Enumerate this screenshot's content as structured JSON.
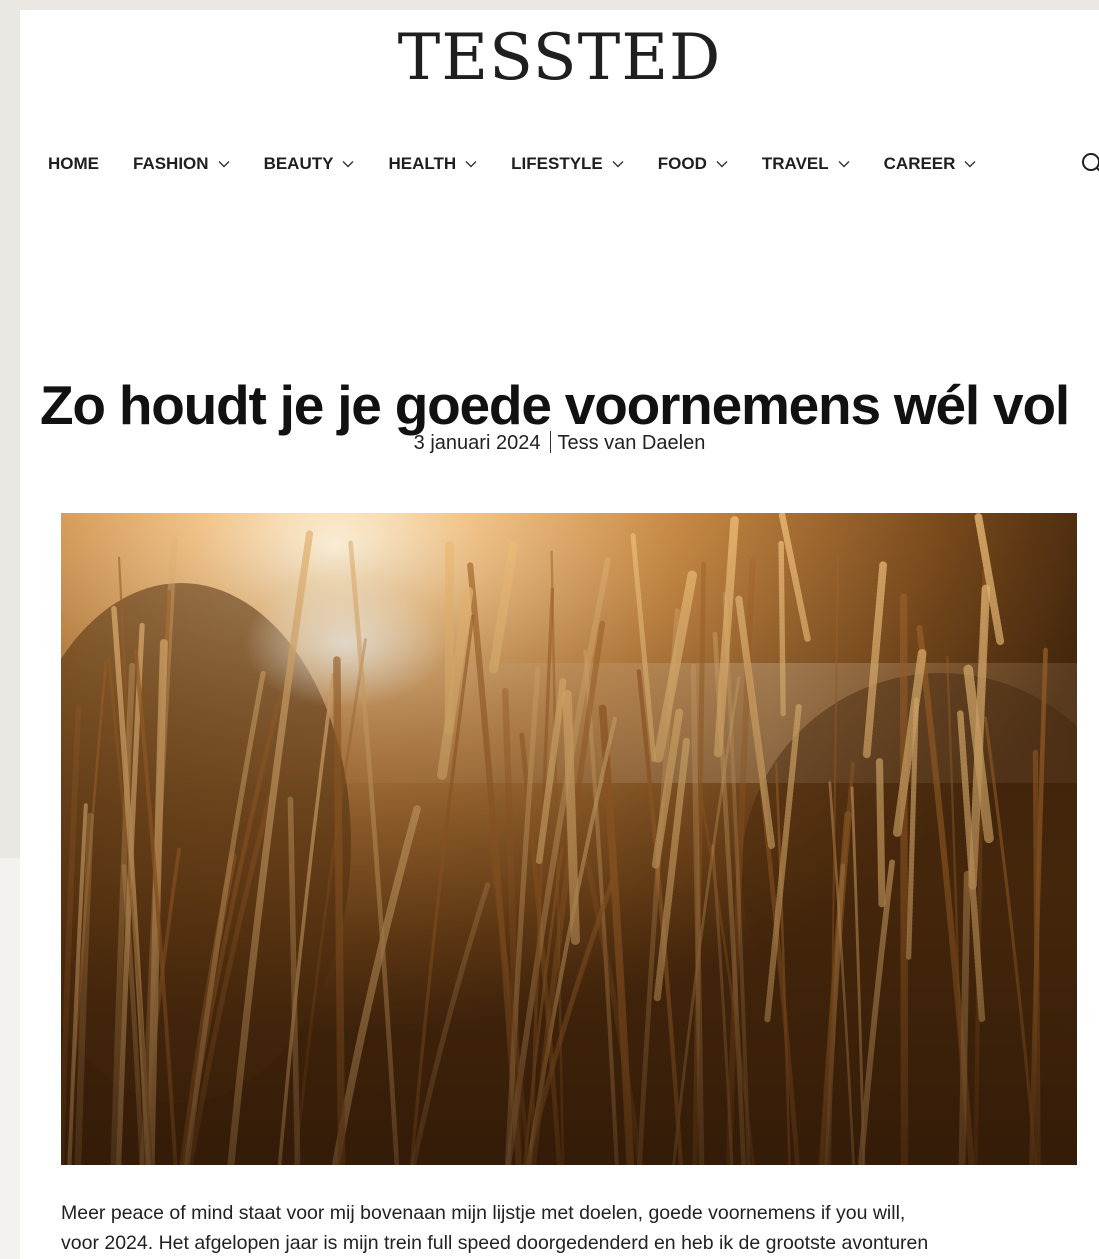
{
  "brand": {
    "logo": "TESSTED"
  },
  "nav": {
    "items": [
      {
        "label": "HOME",
        "dropdown": false
      },
      {
        "label": "FASHION",
        "dropdown": true
      },
      {
        "label": "BEAUTY",
        "dropdown": true
      },
      {
        "label": "HEALTH",
        "dropdown": true
      },
      {
        "label": "LIFESTYLE",
        "dropdown": true
      },
      {
        "label": "FOOD",
        "dropdown": true
      },
      {
        "label": "TRAVEL",
        "dropdown": true
      },
      {
        "label": "CAREER",
        "dropdown": true
      }
    ],
    "search_icon": "search-icon"
  },
  "article": {
    "title": "Zo houdt je je goede voornemens wél vol",
    "date": "3 januari 2024",
    "author": "Tess van Daelen",
    "paragraph_line1": "Meer peace of mind staat voor mij bovenaan mijn lijstje met doelen, goede voornemens if you will,",
    "paragraph_line2": "voor 2024. Het afgelopen jaar is mijn trein full speed doorgedenderd en heb ik de grootste avonturen"
  },
  "colors": {
    "page_bg": "#ebe8e4",
    "content_bg": "#ffffff",
    "text": "#1f1f1f",
    "hero_tone": "#c8803a"
  }
}
